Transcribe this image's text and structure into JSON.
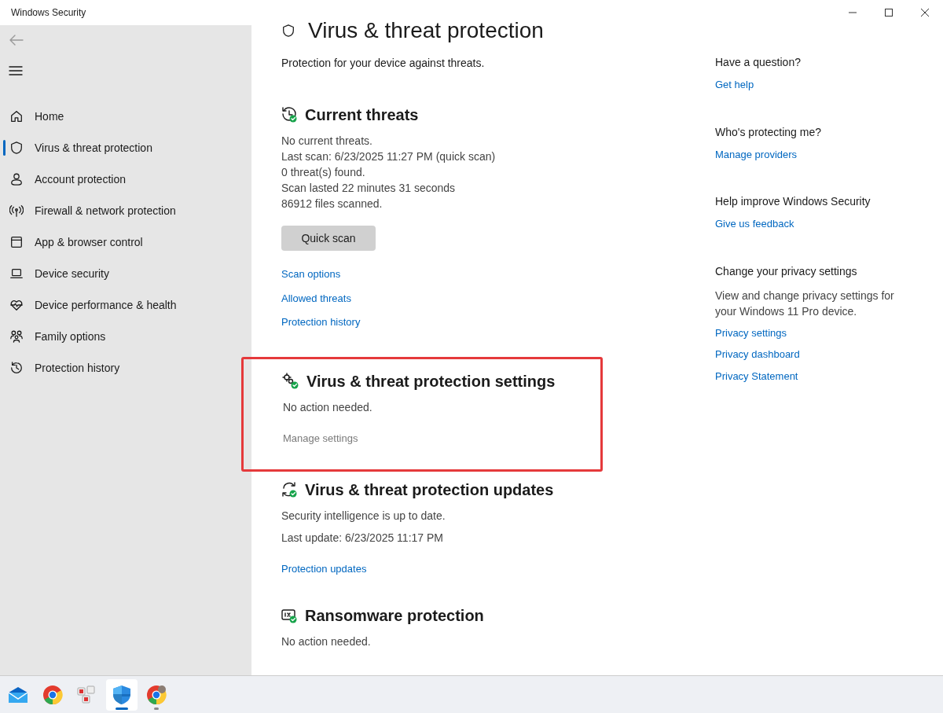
{
  "window": {
    "title": "Windows Security"
  },
  "sidebar": {
    "items": [
      {
        "label": "Home",
        "selected": false
      },
      {
        "label": "Virus & threat protection",
        "selected": true
      },
      {
        "label": "Account protection",
        "selected": false
      },
      {
        "label": "Firewall & network protection",
        "selected": false
      },
      {
        "label": "App & browser control",
        "selected": false
      },
      {
        "label": "Device security",
        "selected": false
      },
      {
        "label": "Device performance & health",
        "selected": false
      },
      {
        "label": "Family options",
        "selected": false
      },
      {
        "label": "Protection history",
        "selected": false
      }
    ]
  },
  "page": {
    "title": "Virus & threat protection",
    "subtitle": "Protection for your device against threats.",
    "sections": [
      {
        "title": "Current threats",
        "highlighted": false,
        "lines": [
          "No current threats.",
          "Last scan: 6/23/2025 11:27 PM (quick scan)",
          "0 threat(s) found.",
          "Scan lasted 22 minutes 31 seconds",
          "86912 files scanned."
        ],
        "button": "Quick scan",
        "links": [
          {
            "label": "Scan options",
            "disabled": false
          },
          {
            "label": "Allowed threats",
            "disabled": false
          },
          {
            "label": "Protection history",
            "disabled": false
          }
        ]
      },
      {
        "title": "Virus & threat protection settings",
        "highlighted": true,
        "lines": [
          "No action needed."
        ],
        "links": [
          {
            "label": "Manage settings",
            "disabled": true
          }
        ]
      },
      {
        "title": "Virus & threat protection updates",
        "highlighted": false,
        "lines": [
          "Security intelligence is up to date.",
          "Last update: 6/23/2025 11:17 PM"
        ],
        "links": [
          {
            "label": "Protection updates",
            "disabled": false
          }
        ]
      },
      {
        "title": "Ransomware protection",
        "highlighted": false,
        "lines": [
          "No action needed."
        ]
      }
    ]
  },
  "aside": [
    {
      "heading": "Have a question?",
      "links": [
        "Get help"
      ]
    },
    {
      "heading": "Who's protecting me?",
      "links": [
        "Manage providers"
      ]
    },
    {
      "heading": "Help improve Windows Security",
      "links": [
        "Give us feedback"
      ]
    },
    {
      "heading": "Change your privacy settings",
      "text": "View and change privacy settings for your Windows 11 Pro device.",
      "links": [
        "Privacy settings",
        "Privacy dashboard",
        "Privacy Statement"
      ]
    }
  ],
  "taskbar": [
    {
      "selected": false,
      "running": false
    },
    {
      "selected": false,
      "running": false
    },
    {
      "selected": false,
      "running": false
    },
    {
      "selected": true,
      "running": true
    },
    {
      "selected": false,
      "running": true
    }
  ]
}
